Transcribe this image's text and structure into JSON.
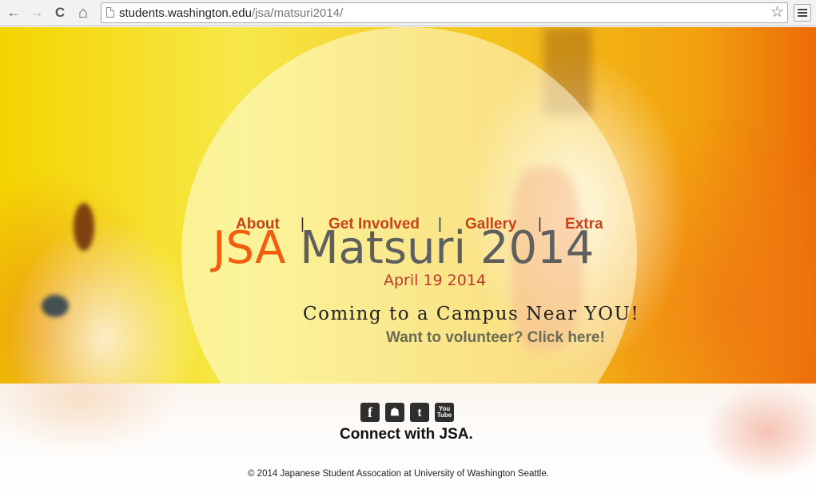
{
  "browser": {
    "url_host": "students.washington.edu",
    "url_path": "/jsa/matsuri2014/",
    "back_icon": "←",
    "forward_icon": "→",
    "reload_icon": "C",
    "home_icon": "⌂",
    "star_icon": "☆"
  },
  "nav": {
    "about": "About",
    "get_involved": "Get Involved",
    "gallery": "Gallery",
    "extra": "Extra",
    "separator": "|"
  },
  "hero": {
    "title_highlight": "JSA",
    "title_rest": " Matsuri 2014",
    "date": "April 19 2014",
    "tagline": "Coming to a Campus Near YOU!",
    "volunteer_link": "Want to volunteer? Click here!"
  },
  "social": {
    "facebook": "f",
    "myspace": "☗",
    "twitter": "t",
    "youtube_top": "You",
    "youtube_bottom": "Tube"
  },
  "footer": {
    "connect": "Connect with JSA.",
    "copyright": "© 2014 Japanese Student Assocation at University of Washington Seattle."
  },
  "colors": {
    "accent_orange": "#f25d0e",
    "nav_red": "#c9421a",
    "title_gray": "#5f5f5f"
  }
}
